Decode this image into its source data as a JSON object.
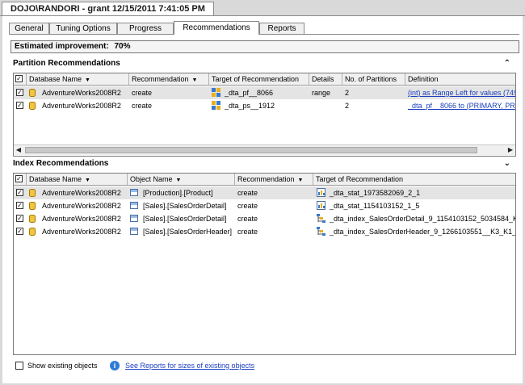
{
  "window": {
    "title": "DOJO\\RANDORI - grant 12/15/2011 7:41:05 PM"
  },
  "tabs": [
    {
      "label": "General",
      "active": false
    },
    {
      "label": "Tuning Options",
      "active": false
    },
    {
      "label": "Progress",
      "active": false
    },
    {
      "label": "Recommendations",
      "active": true
    },
    {
      "label": "Reports",
      "active": false
    }
  ],
  "improvement": {
    "label": "Estimated improvement:",
    "value": "70%"
  },
  "partition": {
    "title": "Partition Recommendations",
    "columns": [
      "Database Name",
      "Recommendation",
      "Target of Recommendation",
      "Details",
      "No. of Partitions",
      "Definition"
    ],
    "rows": [
      {
        "db": "AdventureWorks2008R2",
        "rec": "create",
        "target": "_dta_pf__8066",
        "details": "range",
        "num": "2",
        "def": "(int) as Range Left for values (749",
        "selected": true
      },
      {
        "db": "AdventureWorks2008R2",
        "rec": "create",
        "target": "_dta_ps__1912",
        "details": "",
        "num": "2",
        "def": "_dta_pf__8066 to (PRIMARY, PR",
        "selected": false
      }
    ]
  },
  "index": {
    "title": "Index Recommendations",
    "columns": [
      "Database Name",
      "Object Name",
      "Recommendation",
      "Target of Recommendation"
    ],
    "rows": [
      {
        "db": "AdventureWorks2008R2",
        "obj": "[Production].[Product]",
        "rec": "create",
        "target": "_dta_stat_1973582069_2_1",
        "selected": true
      },
      {
        "db": "AdventureWorks2008R2",
        "obj": "[Sales].[SalesOrderDetail]",
        "rec": "create",
        "target": "_dta_stat_1154103152_1_5",
        "selected": false
      },
      {
        "db": "AdventureWorks2008R2",
        "obj": "[Sales].[SalesOrderDetail]",
        "rec": "create",
        "target": "_dta_index_SalesOrderDetail_9_1154103152_5034584_K",
        "selected": false
      },
      {
        "db": "AdventureWorks2008R2",
        "obj": "[Sales].[SalesOrderHeader]",
        "rec": "create",
        "target": "_dta_index_SalesOrderHeader_9_1266103551__K3_K1_",
        "selected": false
      }
    ]
  },
  "footer": {
    "show_existing": "Show existing objects",
    "reports_link": "See Reports for sizes of existing objects"
  },
  "icons": {
    "sort": "▼",
    "collapse_up": "⌃",
    "collapse_down": "⌄",
    "scroll_left": "◀",
    "scroll_right": "▶",
    "check": "✓",
    "info": "i"
  }
}
